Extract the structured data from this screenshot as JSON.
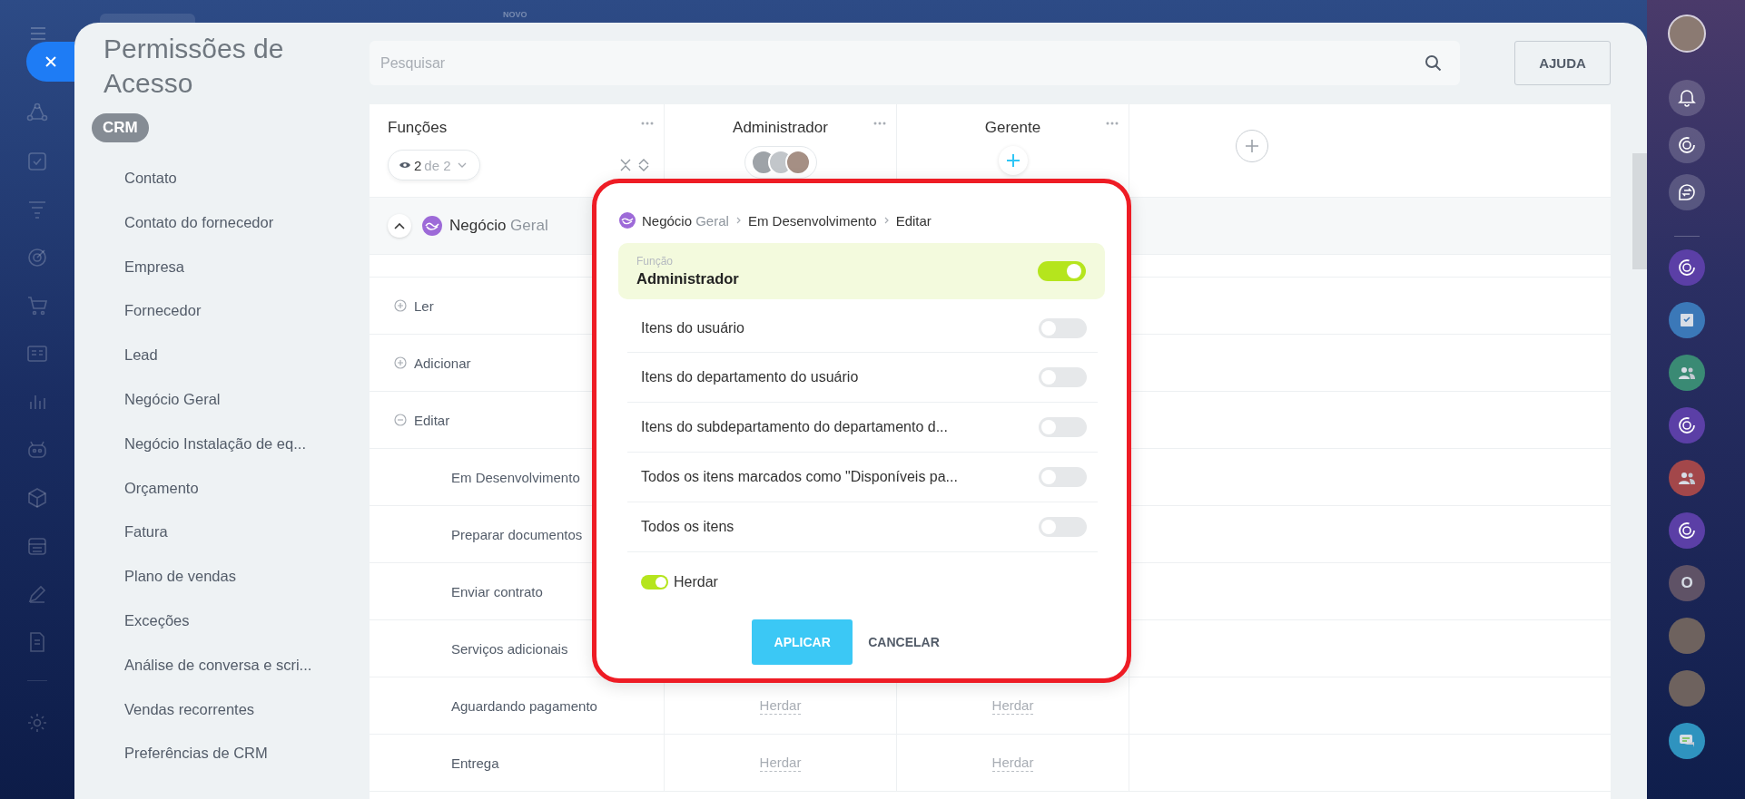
{
  "top_bar": {
    "badge": "NOVO"
  },
  "panel": {
    "title": "Permissões de Acesso",
    "section_badge": "CRM",
    "menu": [
      "Contato",
      "Contato do fornecedor",
      "Empresa",
      "Fornecedor",
      "Lead",
      "Negócio Geral",
      "Negócio Instalação de eq...",
      "Orçamento",
      "Fatura",
      "Plano de vendas",
      "Exceções",
      "Análise de conversa e scri...",
      "Vendas recorrentes",
      "Preferências de CRM"
    ]
  },
  "search": {
    "placeholder": "Pesquisar"
  },
  "help_button": "AJUDA",
  "table": {
    "columns": [
      {
        "title": "Funções",
        "kind": "roles"
      },
      {
        "title": "Administrador",
        "kind": "avatars"
      },
      {
        "title": "Gerente",
        "kind": "add"
      }
    ],
    "filter": {
      "count": "2",
      "total": "de 2"
    },
    "group": {
      "name": "Negócio",
      "suffix": "Geral",
      "expanded": true
    },
    "rows": [
      {
        "label": "Ler",
        "kind": "action",
        "expanded": false
      },
      {
        "label": "Adicionar",
        "kind": "action",
        "expanded": false
      },
      {
        "label": "Editar",
        "kind": "action",
        "expanded": true
      },
      {
        "label": "Em Desenvolvimento",
        "kind": "stage"
      },
      {
        "label": "Preparar documentos",
        "kind": "stage"
      },
      {
        "label": "Enviar contrato",
        "kind": "stage"
      },
      {
        "label": "Serviços adicionais",
        "kind": "stage"
      },
      {
        "label": "Aguardando pagamento",
        "kind": "stage",
        "cells": [
          "Herdar",
          "Herdar"
        ]
      },
      {
        "label": "Entrega",
        "kind": "stage",
        "cells": [
          "Herdar",
          "Herdar"
        ]
      }
    ]
  },
  "popup": {
    "breadcrumb": [
      {
        "text": "Negócio",
        "suffix": "Geral"
      },
      {
        "text": "Em Desenvolvimento"
      },
      {
        "text": "Editar"
      }
    ],
    "role_label": "Função",
    "role": "Administrador",
    "role_on": true,
    "options": [
      {
        "label": "Itens do usuário",
        "on": false
      },
      {
        "label": "Itens do departamento do usuário",
        "on": false
      },
      {
        "label": "Itens do subdepartamento do departamento d...",
        "on": false
      },
      {
        "label": "Todos os itens marcados como \"Disponíveis pa...",
        "on": false
      },
      {
        "label": "Todos os itens",
        "on": false
      }
    ],
    "inherit": {
      "label": "Herdar",
      "on": true
    },
    "buttons": [
      {
        "label": "APLICAR",
        "kind": "primary"
      },
      {
        "label": "CANCELAR",
        "kind": "link"
      }
    ]
  },
  "right_bar": {
    "top": [
      {
        "kind": "avatar"
      }
    ],
    "tools": [
      {
        "kind": "bell"
      },
      {
        "kind": "swirl"
      },
      {
        "kind": "swap"
      }
    ],
    "apps": [
      {
        "kind": "swirl",
        "color": "#5b3fa6"
      },
      {
        "kind": "inbox",
        "color": "#3b78b8"
      },
      {
        "kind": "people",
        "color": "#3a8a74"
      },
      {
        "kind": "swirl",
        "color": "#5b3fa6"
      },
      {
        "kind": "people",
        "color": "#a3474a"
      },
      {
        "kind": "swirl",
        "color": "#5b3fa6"
      },
      {
        "kind": "letter",
        "text": "O",
        "color": "#5f5266"
      },
      {
        "kind": "avatar"
      },
      {
        "kind": "avatar"
      },
      {
        "kind": "chat",
        "color": "#2f93bf"
      }
    ]
  }
}
